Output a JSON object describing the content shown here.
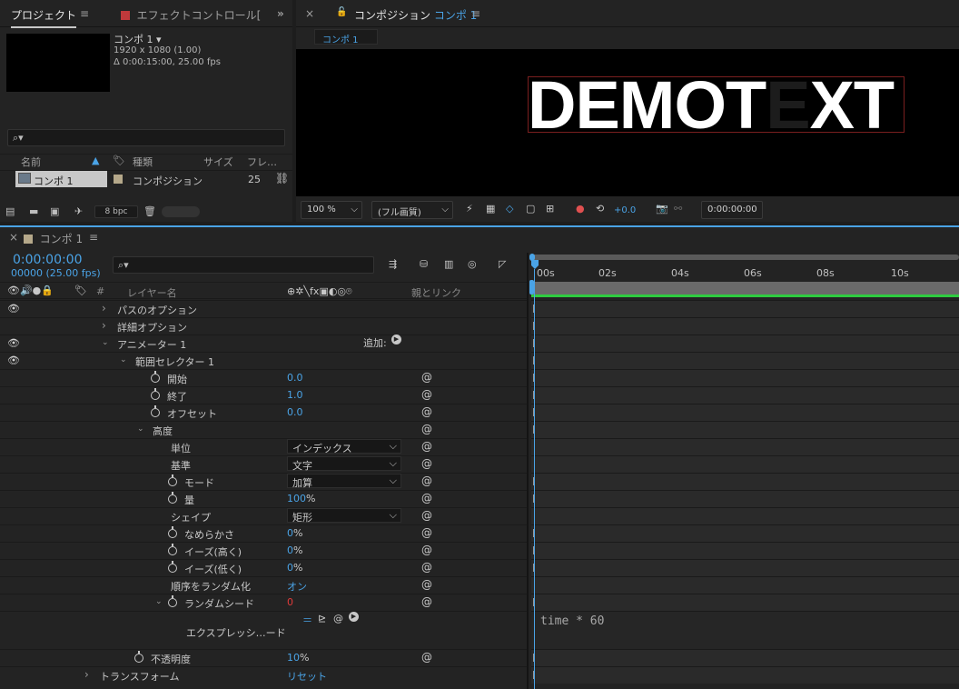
{
  "project": {
    "tab_label": "プロジェクト",
    "menu_icon": "≡",
    "effect_tab_label": "エフェクトコントロール[",
    "overflow_icon": "»",
    "comp_name": "コンポ 1 ▾",
    "comp_size": "1920 x 1080 (1.00)",
    "comp_duration": "Δ 0:00:15:00, 25.00 fps",
    "search_placeholder": "⌕▾",
    "columns": {
      "name": "名前",
      "type": "種類",
      "size": "サイズ",
      "frame": "フレ…"
    },
    "item": {
      "name": "コンポ 1",
      "type": "コンポジション",
      "frame": "25"
    },
    "bpc": "8 bpc"
  },
  "viewer": {
    "close_icon": "×",
    "lock_icon": "🔓",
    "title": "コンポジション",
    "title_comp": "コンポ 1",
    "menu_icon": "≡",
    "sub_tab": "コンポ 1",
    "demo_text_a": "DEMOT",
    "demo_text_dim": "E",
    "demo_text_b": "XT",
    "zoom": "100 %",
    "quality": "(フル画質)",
    "exposure": "+0.0",
    "timecode": "0:00:00:00"
  },
  "timeline": {
    "close_icon": "×",
    "comp_tab": "コンポ 1",
    "menu_icon": "≡",
    "current_time": "0:00:00:00",
    "frame_info": "00000 (25.00 fps)",
    "search_placeholder": "⌕▾",
    "col_hash": "#",
    "col_layer_name": "レイヤー名",
    "col_switches": "⊕✲╲fx▣◐◎⌾",
    "col_parent": "親とリンク",
    "time_ticks": [
      "00s",
      "02s",
      "04s",
      "06s",
      "08s",
      "10s"
    ],
    "add_label": "追加:",
    "expression_text": "time * 60",
    "rows": [
      {
        "label": "パスのオプション"
      },
      {
        "label": "詳細オプション"
      },
      {
        "label": "アニメーター 1"
      },
      {
        "label": "範囲セレクター 1"
      },
      {
        "label": "開始",
        "value": "0.0"
      },
      {
        "label": "終了",
        "value": "1.0"
      },
      {
        "label": "オフセット",
        "value": "0.0"
      },
      {
        "label": "高度"
      },
      {
        "label": "単位",
        "value": "インデックス"
      },
      {
        "label": "基準",
        "value": "文字"
      },
      {
        "label": "モード",
        "value": "加算"
      },
      {
        "label": "量",
        "value": "100",
        "unit": "%"
      },
      {
        "label": "シェイプ",
        "value": "矩形"
      },
      {
        "label": "なめらかさ",
        "value": "0",
        "unit": "%"
      },
      {
        "label": "イーズ(高く)",
        "value": "0",
        "unit": "%"
      },
      {
        "label": "イーズ(低く)",
        "value": "0",
        "unit": "%"
      },
      {
        "label": "順序をランダム化",
        "value": "オン"
      },
      {
        "label": "ランダムシード",
        "value": "0"
      },
      {
        "label": "エクスプレッシ…ード"
      },
      {
        "label": "不透明度",
        "value": "10",
        "unit": "%"
      },
      {
        "label": "トランスフォーム",
        "value": "リセット"
      }
    ]
  },
  "colors": {
    "accent_blue": "#4aa3e6",
    "value_red": "#e03a3a",
    "work_area_green": "#2ecc40",
    "comp_swatch": "#b5a88a",
    "effect_swatch": "#c0393b"
  }
}
